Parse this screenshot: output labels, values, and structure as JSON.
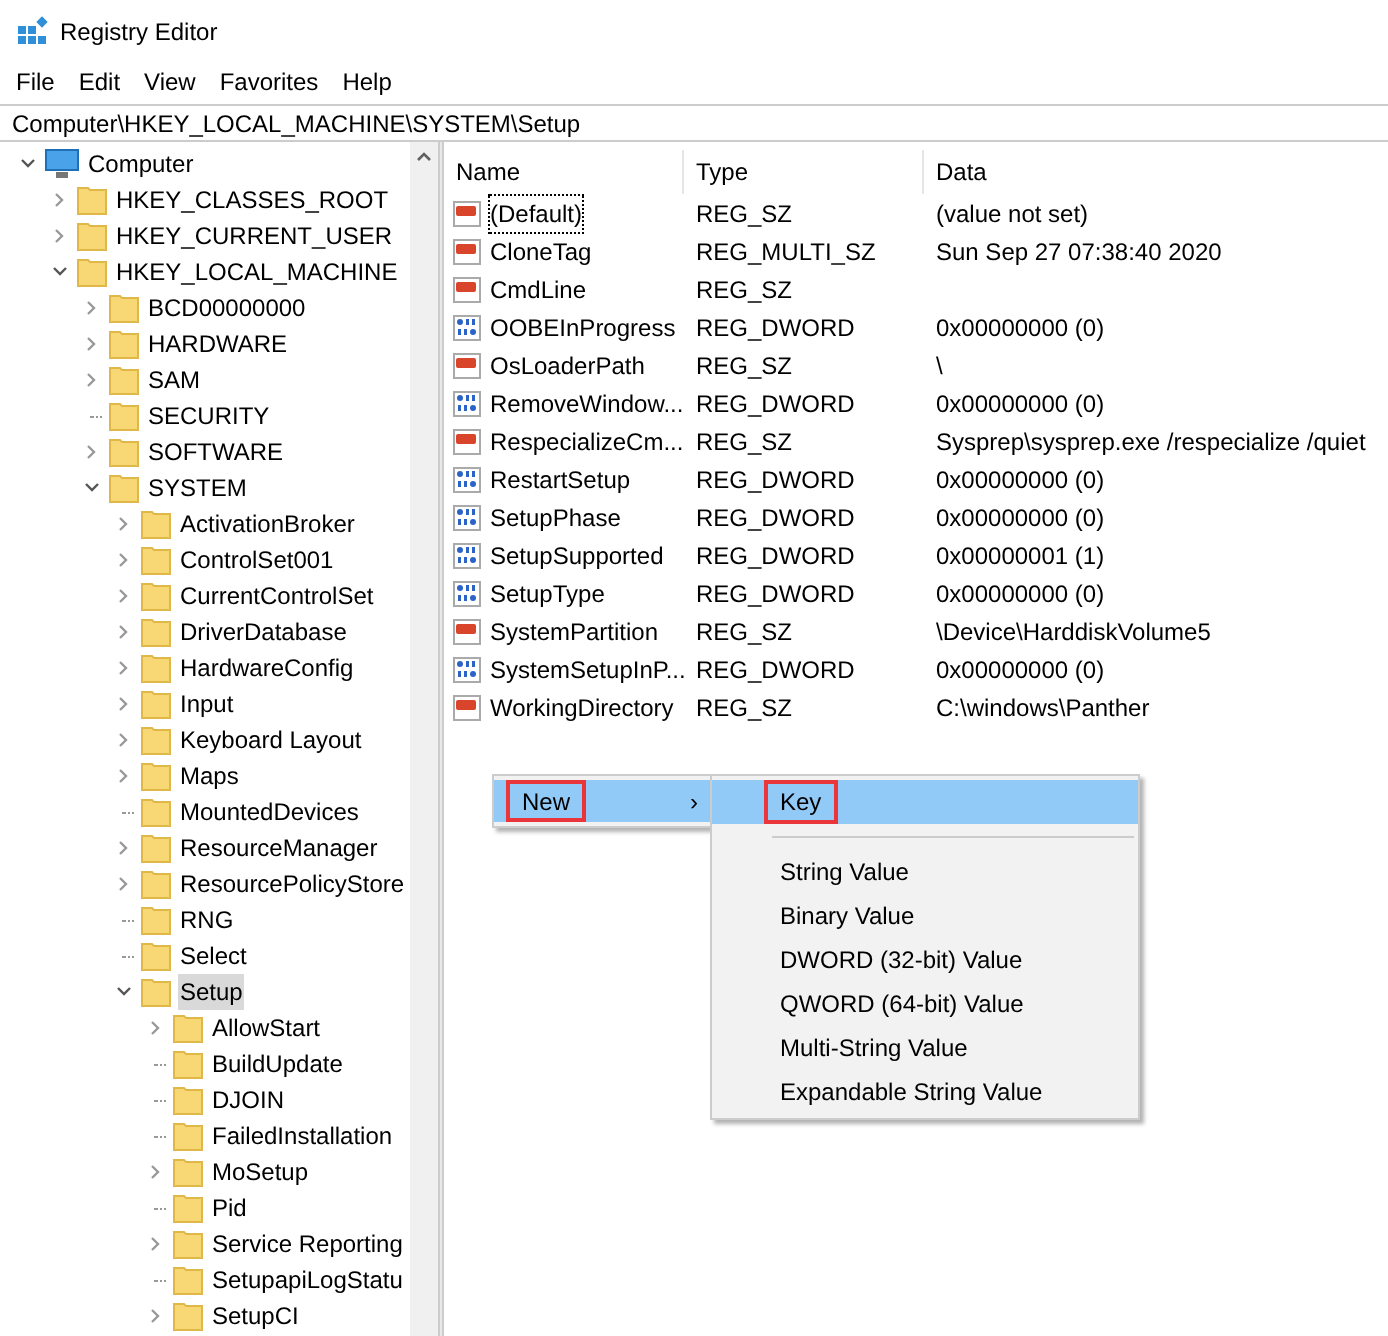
{
  "window": {
    "title": "Registry Editor"
  },
  "menu_bar": [
    "File",
    "Edit",
    "View",
    "Favorites",
    "Help"
  ],
  "address_bar": "Computer\\HKEY_LOCAL_MACHINE\\SYSTEM\\Setup",
  "tree": [
    {
      "label": "Computer",
      "kind": "computer",
      "expandable": true,
      "selected": false,
      "children": [
        {
          "label": "HKEY_CLASSES_ROOT",
          "kind": "folder",
          "expandable": true,
          "selected": false
        },
        {
          "label": "HKEY_CURRENT_USER",
          "kind": "folder",
          "expandable": true,
          "selected": false
        },
        {
          "label": "HKEY_LOCAL_MACHINE",
          "kind": "folder",
          "expandable": true,
          "selected": false,
          "children": [
            {
              "label": "BCD00000000",
              "kind": "folder",
              "expandable": true,
              "selected": false
            },
            {
              "label": "HARDWARE",
              "kind": "folder",
              "expandable": true,
              "selected": false
            },
            {
              "label": "SAM",
              "kind": "folder",
              "expandable": true,
              "selected": false
            },
            {
              "label": "SECURITY",
              "kind": "folder",
              "expandable": false,
              "selected": false
            },
            {
              "label": "SOFTWARE",
              "kind": "folder",
              "expandable": true,
              "selected": false
            },
            {
              "label": "SYSTEM",
              "kind": "folder",
              "expandable": true,
              "selected": false,
              "children": [
                {
                  "label": "ActivationBroker",
                  "kind": "folder",
                  "expandable": true,
                  "selected": false
                },
                {
                  "label": "ControlSet001",
                  "kind": "folder",
                  "expandable": true,
                  "selected": false
                },
                {
                  "label": "CurrentControlSet",
                  "kind": "folder",
                  "expandable": true,
                  "selected": false
                },
                {
                  "label": "DriverDatabase",
                  "kind": "folder",
                  "expandable": true,
                  "selected": false
                },
                {
                  "label": "HardwareConfig",
                  "kind": "folder",
                  "expandable": true,
                  "selected": false
                },
                {
                  "label": "Input",
                  "kind": "folder",
                  "expandable": true,
                  "selected": false
                },
                {
                  "label": "Keyboard Layout",
                  "kind": "folder",
                  "expandable": true,
                  "selected": false
                },
                {
                  "label": "Maps",
                  "kind": "folder",
                  "expandable": true,
                  "selected": false
                },
                {
                  "label": "MountedDevices",
                  "kind": "folder",
                  "expandable": false,
                  "selected": false
                },
                {
                  "label": "ResourceManager",
                  "kind": "folder",
                  "expandable": true,
                  "selected": false
                },
                {
                  "label": "ResourcePolicyStore",
                  "kind": "folder",
                  "expandable": true,
                  "selected": false
                },
                {
                  "label": "RNG",
                  "kind": "folder",
                  "expandable": false,
                  "selected": false
                },
                {
                  "label": "Select",
                  "kind": "folder",
                  "expandable": false,
                  "selected": false
                },
                {
                  "label": "Setup",
                  "kind": "folder",
                  "expandable": true,
                  "selected": true,
                  "children": [
                    {
                      "label": "AllowStart",
                      "kind": "folder",
                      "expandable": true,
                      "selected": false
                    },
                    {
                      "label": "BuildUpdate",
                      "kind": "folder",
                      "expandable": false,
                      "selected": false
                    },
                    {
                      "label": "DJOIN",
                      "kind": "folder",
                      "expandable": false,
                      "selected": false
                    },
                    {
                      "label": "FailedInstallation",
                      "kind": "folder",
                      "expandable": false,
                      "selected": false
                    },
                    {
                      "label": "MoSetup",
                      "kind": "folder",
                      "expandable": true,
                      "selected": false
                    },
                    {
                      "label": "Pid",
                      "kind": "folder",
                      "expandable": false,
                      "selected": false
                    },
                    {
                      "label": "Service Reporting",
                      "kind": "folder",
                      "expandable": true,
                      "selected": false
                    },
                    {
                      "label": "SetupapiLogStatu",
                      "kind": "folder",
                      "expandable": false,
                      "selected": false
                    },
                    {
                      "label": "SetupCI",
                      "kind": "folder",
                      "expandable": true,
                      "selected": false
                    }
                  ]
                }
              ]
            }
          ]
        }
      ]
    }
  ],
  "values": {
    "columns": [
      "Name",
      "Type",
      "Data"
    ],
    "rows": [
      {
        "kind": "string",
        "name": "(Default)",
        "type": "REG_SZ",
        "data": "(value not set)",
        "focused": true
      },
      {
        "kind": "string",
        "name": "CloneTag",
        "type": "REG_MULTI_SZ",
        "data": "Sun Sep 27 07:38:40 2020",
        "focused": false
      },
      {
        "kind": "string",
        "name": "CmdLine",
        "type": "REG_SZ",
        "data": "",
        "focused": false
      },
      {
        "kind": "dword",
        "name": "OOBEInProgress",
        "type": "REG_DWORD",
        "data": "0x00000000 (0)",
        "focused": false
      },
      {
        "kind": "string",
        "name": "OsLoaderPath",
        "type": "REG_SZ",
        "data": "\\",
        "focused": false
      },
      {
        "kind": "dword",
        "name": "RemoveWindow...",
        "type": "REG_DWORD",
        "data": "0x00000000 (0)",
        "focused": false
      },
      {
        "kind": "string",
        "name": "RespecializeCm...",
        "type": "REG_SZ",
        "data": "Sysprep\\sysprep.exe /respecialize /quiet",
        "focused": false
      },
      {
        "kind": "dword",
        "name": "RestartSetup",
        "type": "REG_DWORD",
        "data": "0x00000000 (0)",
        "focused": false
      },
      {
        "kind": "dword",
        "name": "SetupPhase",
        "type": "REG_DWORD",
        "data": "0x00000000 (0)",
        "focused": false
      },
      {
        "kind": "dword",
        "name": "SetupSupported",
        "type": "REG_DWORD",
        "data": "0x00000001 (1)",
        "focused": false
      },
      {
        "kind": "dword",
        "name": "SetupType",
        "type": "REG_DWORD",
        "data": "0x00000000 (0)",
        "focused": false
      },
      {
        "kind": "string",
        "name": "SystemPartition",
        "type": "REG_SZ",
        "data": "\\Device\\HarddiskVolume5",
        "focused": false
      },
      {
        "kind": "dword",
        "name": "SystemSetupInP...",
        "type": "REG_DWORD",
        "data": "0x00000000 (0)",
        "focused": false
      },
      {
        "kind": "string",
        "name": "WorkingDirectory",
        "type": "REG_SZ",
        "data": "C:\\windows\\Panther",
        "focused": false
      }
    ]
  },
  "context_menu": {
    "items": [
      {
        "label": "New",
        "arrow": "›",
        "selected": true,
        "outlined": true
      }
    ]
  },
  "submenu": {
    "items": [
      {
        "label": "Key",
        "selected": true,
        "outlined": true,
        "separator_after": true
      },
      {
        "label": "String Value",
        "selected": false,
        "outlined": false,
        "separator_after": false
      },
      {
        "label": "Binary Value",
        "selected": false,
        "outlined": false,
        "separator_after": false
      },
      {
        "label": "DWORD (32-bit) Value",
        "selected": false,
        "outlined": false,
        "separator_after": false
      },
      {
        "label": "QWORD (64-bit) Value",
        "selected": false,
        "outlined": false,
        "separator_after": false
      },
      {
        "label": "Multi-String Value",
        "selected": false,
        "outlined": false,
        "separator_after": false
      },
      {
        "label": "Expandable String Value",
        "selected": false,
        "outlined": false,
        "separator_after": false
      }
    ]
  }
}
